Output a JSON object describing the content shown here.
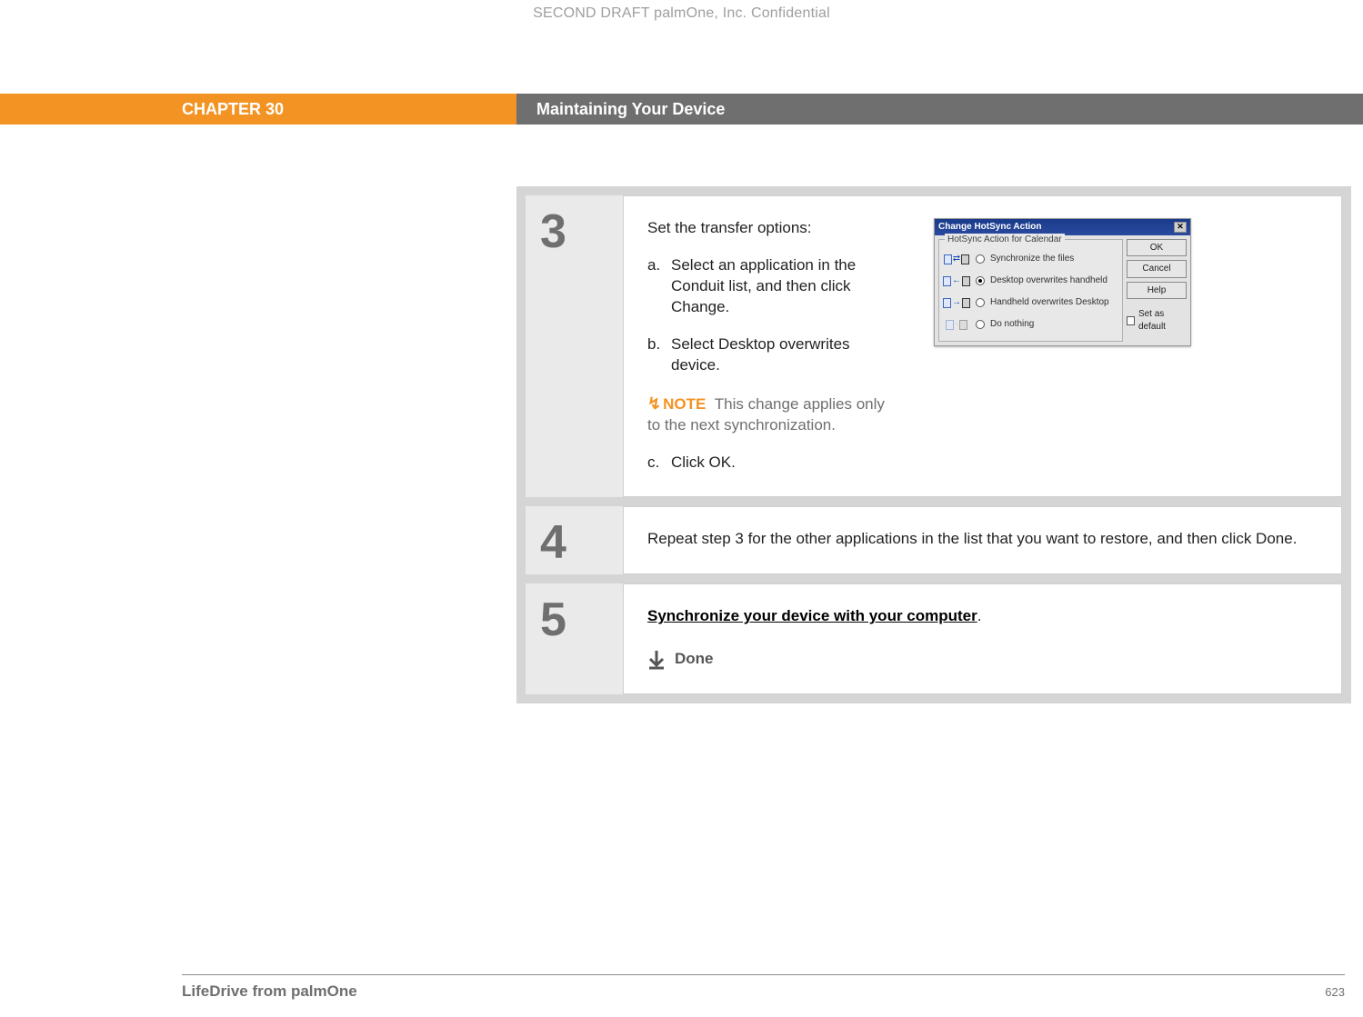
{
  "confidential": "SECOND DRAFT palmOne, Inc.  Confidential",
  "chapter": {
    "label": "CHAPTER 30",
    "title": "Maintaining Your Device"
  },
  "steps": {
    "s3": {
      "num": "3",
      "intro": "Set the transfer options:",
      "a_marker": "a.",
      "a_text": "Select an application in the Conduit list, and then click Change.",
      "b_marker": "b.",
      "b_text": "Select Desktop overwrites device.",
      "note_label": "NOTE",
      "note_text": "This change applies only to the next synchronization.",
      "c_marker": "c.",
      "c_text": "Click OK."
    },
    "s4": {
      "num": "4",
      "text": "Repeat step 3 for the other applications in the list that you want to restore, and then click Done."
    },
    "s5": {
      "num": "5",
      "link": "Synchronize your device with your computer",
      "period": ".",
      "done": "Done"
    }
  },
  "dialog": {
    "title": "Change HotSync Action",
    "group": "HotSync Action for Calendar",
    "opt1": "Synchronize the files",
    "opt2": "Desktop overwrites handheld",
    "opt3": "Handheld overwrites Desktop",
    "opt4": "Do nothing",
    "btn_ok": "OK",
    "btn_cancel": "Cancel",
    "btn_help": "Help",
    "chk": "Set as default"
  },
  "footer": {
    "product": "LifeDrive from palmOne",
    "page": "623"
  }
}
